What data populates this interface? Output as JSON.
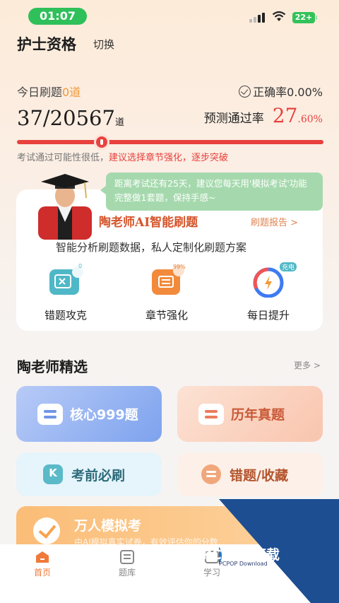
{
  "status_bar": {
    "time": "01:07",
    "battery": "22+"
  },
  "header": {
    "title": "护士资格",
    "switch_label": "切换"
  },
  "stats": {
    "today_label": "今日刷题",
    "today_count": "0道",
    "accuracy_label": "正确率0.00%",
    "done_count": "37/20567",
    "done_unit": "道",
    "predict_label": "预测通过率",
    "predict_big": "27",
    "predict_small": ".60%",
    "progress_fraction": 0.276,
    "hint_prefix": "考试通过可能性很低，",
    "hint_red": "建议选择章节强化，逐步突破"
  },
  "ai_card": {
    "bubble": "距离考试还有25天，建议您每天用'模拟考试'功能完整做1套题，保持手感~",
    "title": "陶老师AI智能刷题",
    "report_label": "刷题报告 >",
    "subtitle": "智能分析刷题数据，私人定制化刷题方案",
    "features": [
      {
        "label": "错题攻克",
        "badge": "0",
        "icon": "wrong-question-icon"
      },
      {
        "label": "章节强化",
        "badge": "99%",
        "icon": "chapter-list-icon"
      },
      {
        "label": "每日提升",
        "badge": "充电",
        "icon": "lightning-ring-icon"
      }
    ]
  },
  "section": {
    "title": "陶老师精选",
    "more": "更多 >",
    "tiles": [
      {
        "label": "核心999题",
        "icon": "core-questions-icon"
      },
      {
        "label": "历年真题",
        "icon": "past-exams-icon"
      },
      {
        "label": "考前必刷",
        "icon": "k-icon"
      },
      {
        "label": "错题/收藏",
        "icon": "favorites-icon"
      }
    ],
    "banner": {
      "title": "万人模拟考",
      "subtitle": "由AI模拟真实试卷，有效评估你的分数"
    }
  },
  "tabbar": [
    {
      "label": "首页",
      "active": true
    },
    {
      "label": "题库",
      "active": false
    },
    {
      "label": "学习",
      "active": false
    }
  ],
  "watermark": {
    "brand": "PCPOP下载",
    "domain": "PCPOP Download"
  },
  "colors": {
    "accent_red": "#e8413e",
    "accent_orange": "#f0983b",
    "green": "#2fc05a"
  }
}
